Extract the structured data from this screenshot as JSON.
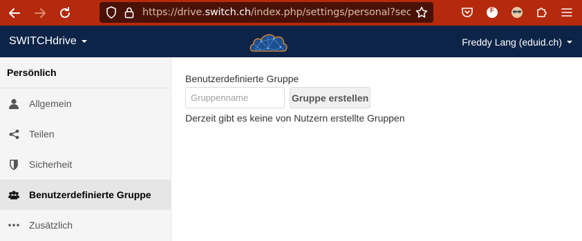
{
  "browser": {
    "url_prefix": "https://drive.",
    "url_host": "switch.ch",
    "url_suffix": "/index.php/settings/personal?sectionid=cu",
    "profile_letter": "F"
  },
  "header": {
    "brand": "SWITCHdrive",
    "user": "Freddy Lang (eduid.ch)"
  },
  "sidebar": {
    "title": "Persönlich",
    "items": [
      {
        "label": "Allgemein",
        "icon": "user-icon"
      },
      {
        "label": "Teilen",
        "icon": "share-icon"
      },
      {
        "label": "Sicherheit",
        "icon": "shield-icon"
      },
      {
        "label": "Benutzerdefinierte Gruppe",
        "icon": "users-icon",
        "active": true
      },
      {
        "label": "Zusätzlich",
        "icon": "more-dots-icon"
      }
    ]
  },
  "main": {
    "section_title": "Benutzerdefinierte Gruppe",
    "input_placeholder": "Gruppenname",
    "create_button": "Gruppe erstellen",
    "empty_message": "Derzeit gibt es keine von Nutzern erstellte Gruppen"
  },
  "colors": {
    "browser_bar": "#b52a0c",
    "app_header": "#0d2448",
    "sidebar_bg": "#f5f5f5",
    "active_item_bg": "#e6e6e6"
  }
}
